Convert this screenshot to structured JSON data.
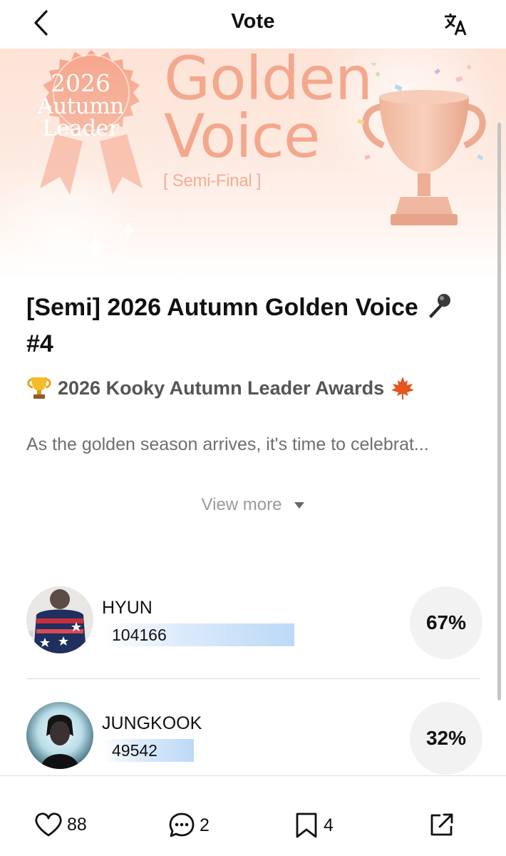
{
  "header": {
    "title": "Vote"
  },
  "banner": {
    "rosette_year": "2026",
    "rosette_line2": "Autumn",
    "rosette_line3": "Leader",
    "title_line1": "Golden",
    "title_line2": "Voice",
    "subtitle": "[ Semi-Final ]"
  },
  "post": {
    "title": "[Semi] 2026 Autumn Golden Voice",
    "title_suffix": "#4",
    "award_line": "2026 Kooky Autumn Leader Awards",
    "description": "As the golden season arrives, it's time to celebrat...",
    "view_more": "View more"
  },
  "candidates": [
    {
      "name": "HYUN",
      "votes": "104166",
      "percent": "67%",
      "share": 0.67
    },
    {
      "name": "JUNGKOOK",
      "votes": "49542",
      "percent": "32%",
      "share": 0.32
    }
  ],
  "bottom_bar": {
    "likes": "88",
    "comments": "2",
    "bookmarks": "4"
  },
  "colors": {
    "banner_peach": "#f3a88e",
    "bar_blue": "#bcd9f6",
    "percent_bg": "#f2f2f2"
  },
  "icons": [
    "back-arrow-icon",
    "translate-icon",
    "microphone-icon",
    "trophy-icon",
    "maple-leaf-icon",
    "triangle-down-icon",
    "heart-icon",
    "comment-icon",
    "bookmark-icon",
    "share-icon"
  ]
}
